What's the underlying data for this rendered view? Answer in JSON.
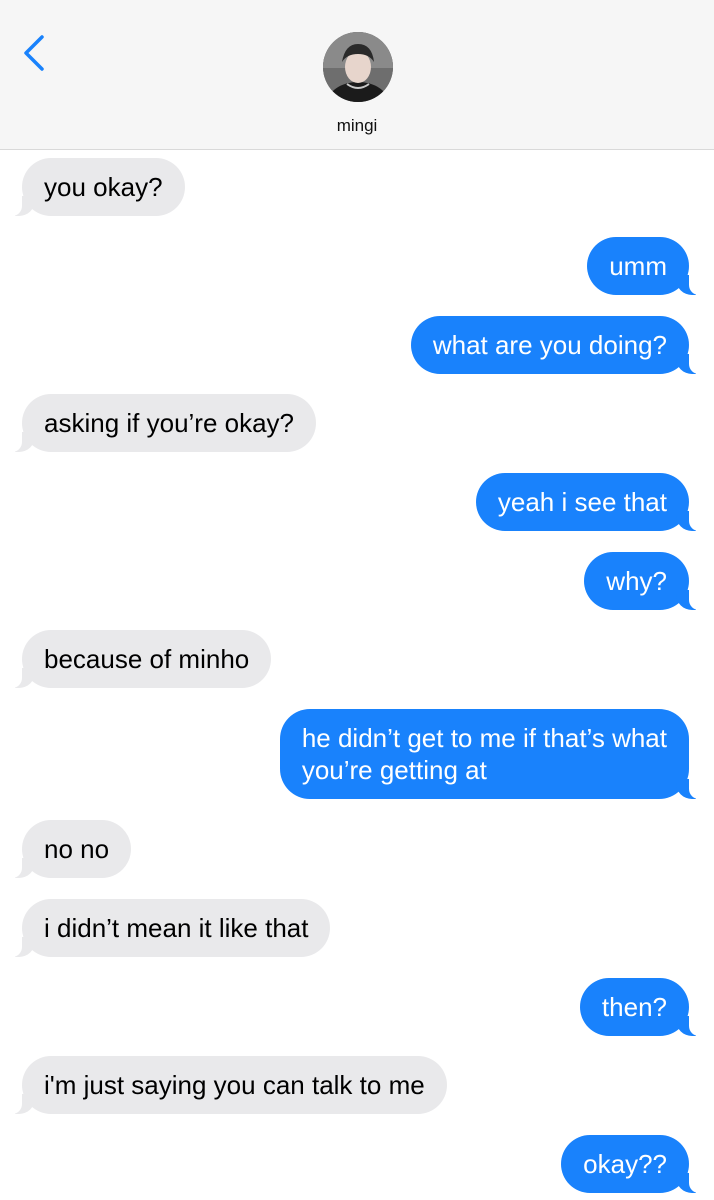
{
  "header": {
    "back_icon": "chevron-left-icon",
    "contact_name": "mingi",
    "accent_color": "#1982fc"
  },
  "colors": {
    "sent_bubble": "#1982fc",
    "received_bubble": "#e9e9eb"
  },
  "messages": [
    {
      "direction": "received",
      "text": "you okay?"
    },
    {
      "direction": "sent",
      "text": "umm"
    },
    {
      "direction": "sent",
      "text": "what are you doing?"
    },
    {
      "direction": "received",
      "text": "asking if you’re okay?"
    },
    {
      "direction": "sent",
      "text": "yeah i see that"
    },
    {
      "direction": "sent",
      "text": "why?"
    },
    {
      "direction": "received",
      "text": "because of minho"
    },
    {
      "direction": "sent",
      "text": "he didn’t get to me if that’s what\nyou’re getting at"
    },
    {
      "direction": "received",
      "text": "no no"
    },
    {
      "direction": "received",
      "text": "i didn’t mean it like that"
    },
    {
      "direction": "sent",
      "text": "then?"
    },
    {
      "direction": "received",
      "text": "i'm just saying you can talk to me"
    },
    {
      "direction": "sent",
      "text": "okay??"
    }
  ]
}
